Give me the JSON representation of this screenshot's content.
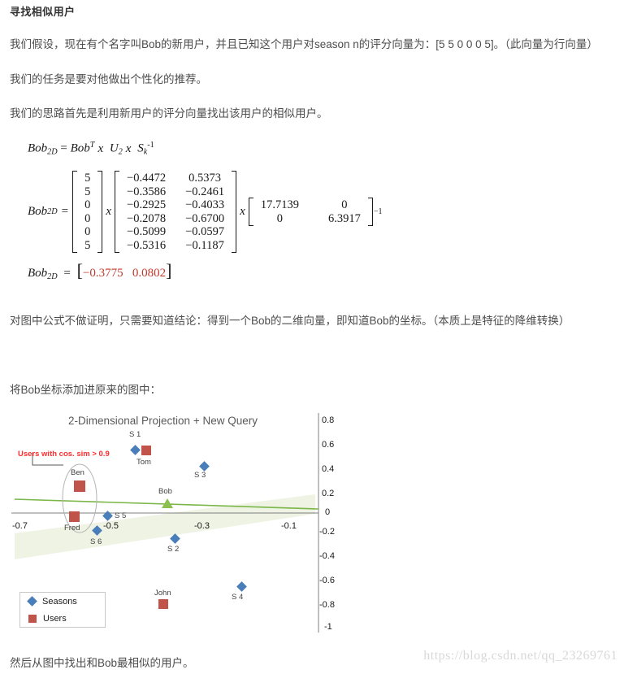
{
  "heading": "寻找相似用户",
  "paragraphs": {
    "p1": "我们假设，现在有个名字叫Bob的新用户，并且已知这个用户对season n的评分向量为：[5 5 0 0 0 5]。（此向量为行向量）",
    "p2": "我们的任务是要对他做出个性化的推荐。",
    "p3": "我们的思路首先是利用新用户的评分向量找出该用户的相似用户。",
    "p4": "对图中公式不做证明，只需要知道结论：得到一个Bob的二维向量，即知道Bob的坐标。（本质上是特征的降维转换）",
    "p5": "将Bob坐标添加进原来的图中：",
    "p6": "然后从图中找出和Bob最相似的用户。"
  },
  "formula": {
    "lhs": "Bob",
    "lhs_sub": "2D",
    "eq": "=",
    "line1_rhs": "Bob",
    "line1_sup": "T",
    "times": "x",
    "line1_u": "U",
    "line1_u_sub": "2",
    "line1_s": "S",
    "line1_s_sub": "k",
    "line1_s_sup": "-1",
    "bob_vector": [
      "5",
      "5",
      "0",
      "0",
      "0",
      "5"
    ],
    "u_matrix": [
      [
        "−0.4472",
        "0.5373"
      ],
      [
        "−0.3586",
        "−0.2461"
      ],
      [
        "−0.2925",
        "−0.4033"
      ],
      [
        "−0.2078",
        "−0.6700"
      ],
      [
        "−0.5099",
        "−0.0597"
      ],
      [
        "−0.5316",
        "−0.1187"
      ]
    ],
    "s_matrix": [
      [
        "17.7139",
        "0"
      ],
      [
        "0",
        "6.3917"
      ]
    ],
    "s_inverse_exp": "−1",
    "result": [
      "−0.3775",
      "0.0802"
    ]
  },
  "chart_data": {
    "type": "scatter",
    "title": "2-Dimensional Projection + New Query",
    "xlabel": "",
    "ylabel": "",
    "xlim": [
      -0.78,
      -0.02
    ],
    "ylim": [
      -1,
      0.8
    ],
    "xticks": [
      "-0.7",
      "-0.5",
      "-0.3",
      "-0.1"
    ],
    "xtick_values": [
      -0.7,
      -0.5,
      -0.3,
      -0.1
    ],
    "yticks": [
      "0.8",
      "0.6",
      "0.4",
      "0.2",
      "0",
      "-0.2",
      "-0.4",
      "-0.6",
      "-0.8",
      "-1"
    ],
    "ytick_values": [
      0.8,
      0.6,
      0.4,
      0.2,
      0,
      -0.2,
      -0.4,
      -0.6,
      -0.8,
      -1
    ],
    "y_axis_position": "right",
    "grid": false,
    "legend": {
      "position": "bottom-left",
      "entries": [
        {
          "label": "Seasons",
          "marker": "diamond",
          "color": "#4a7ebb"
        },
        {
          "label": "Users",
          "marker": "square",
          "color": "#c0544a"
        }
      ]
    },
    "annotation": {
      "text": "Users with cos. sim > 0.9",
      "color": "#ff2d2d",
      "highlight_shape": "ellipse",
      "highlighted_points": [
        "Ben",
        "Fred"
      ]
    },
    "trendline": {
      "color": "#7ab648",
      "band_color": "#eef3e4"
    },
    "series": [
      {
        "name": "Seasons",
        "marker": "diamond",
        "color": "#4a7ebb",
        "points": [
          {
            "label": "S 1",
            "x": -0.425,
            "y": 0.545
          },
          {
            "label": "S 3",
            "x": -0.281,
            "y": 0.405
          },
          {
            "label": "S 5",
            "x": -0.513,
            "y": -0.085
          },
          {
            "label": "S 6",
            "x": -0.539,
            "y": -0.155
          },
          {
            "label": "S 2",
            "x": -0.343,
            "y": -0.205
          },
          {
            "label": "S 4",
            "x": -0.178,
            "y": -0.655
          }
        ]
      },
      {
        "name": "Users",
        "marker": "square",
        "color": "#c0544a",
        "points": [
          {
            "label": "Tom",
            "x": -0.397,
            "y": 0.54
          },
          {
            "label": "Ben",
            "x": -0.566,
            "y": 0.245
          },
          {
            "label": "Fred",
            "x": -0.578,
            "y": -0.095
          },
          {
            "label": "John",
            "x": -0.36,
            "y": -0.775
          }
        ]
      },
      {
        "name": "New Query",
        "marker": "triangle",
        "color": "#8cc04e",
        "points": [
          {
            "label": "Bob",
            "x": -0.3775,
            "y": 0.0802
          }
        ]
      }
    ]
  },
  "watermark": "https://blog.csdn.net/qq_23269761"
}
